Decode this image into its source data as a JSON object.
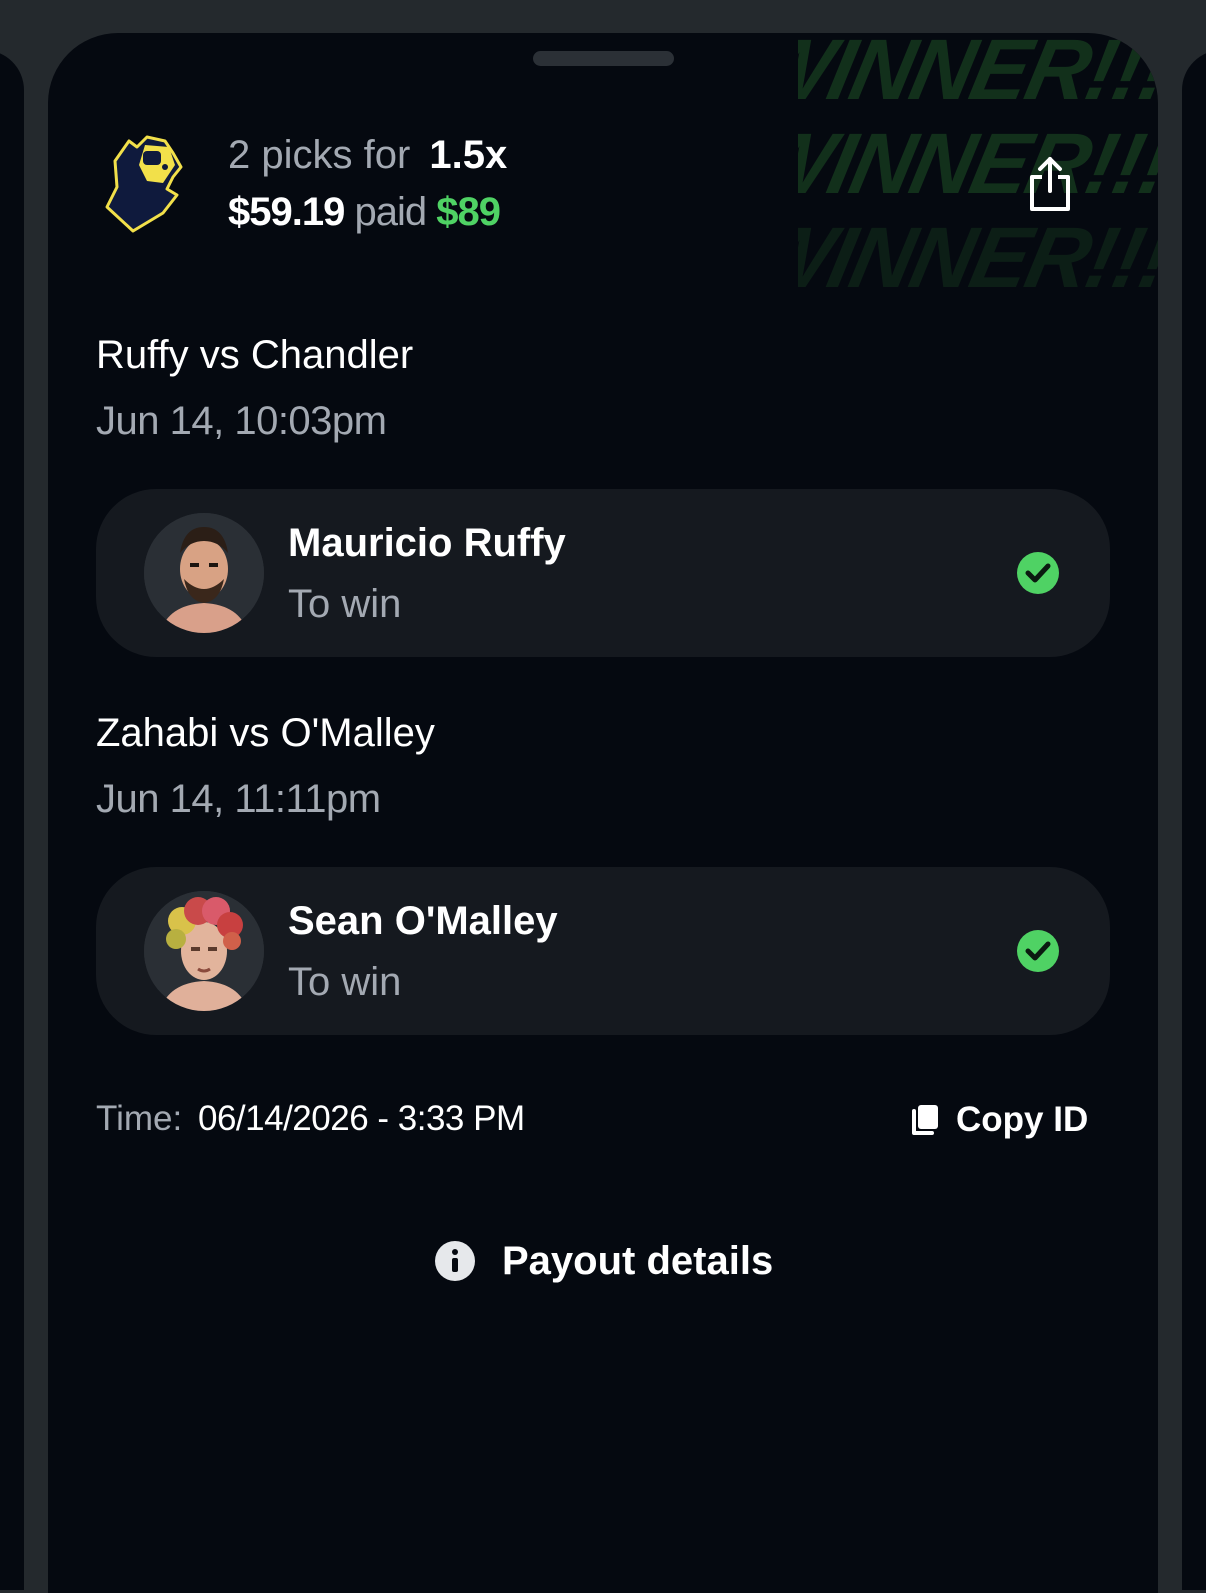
{
  "background_text": {
    "winner_lines": [
      "WINNER!!!",
      "WINNER!!!",
      "WINNER!!!"
    ]
  },
  "header": {
    "picks_text": "2 picks for",
    "multiplier": "1.5x",
    "stake": "$59.19",
    "paid_text": "paid",
    "payout": "$89"
  },
  "colors": {
    "accent_green": "#4fd264",
    "logo_yellow": "#f2e04a"
  },
  "icons": {
    "share": "share-icon",
    "check": "check-circle-icon",
    "copy": "copy-icon",
    "info": "info-icon",
    "logo": "mascot-logo"
  },
  "picks": [
    {
      "matchup": "Ruffy vs Chandler",
      "date": "Jun 14, 10:03pm",
      "player": "Mauricio Ruffy",
      "pick_type": "To win",
      "status": "won"
    },
    {
      "matchup": "Zahabi vs O'Malley",
      "date": "Jun 14, 11:11pm",
      "player": "Sean O'Malley",
      "pick_type": "To win",
      "status": "won"
    }
  ],
  "footer": {
    "time_label": "Time:",
    "time_value": "06/14/2026 - 3:33 PM",
    "copy_label": "Copy ID",
    "payout_details_label": "Payout details"
  }
}
